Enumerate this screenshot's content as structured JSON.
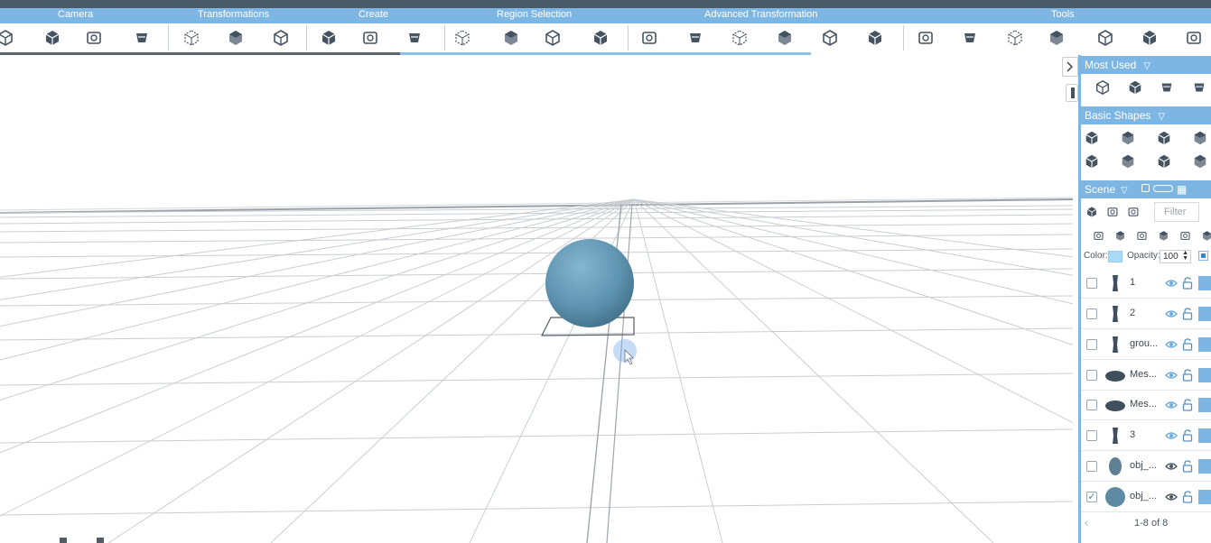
{
  "categories": [
    "Camera",
    "Transformations",
    "Create",
    "Region Selection",
    "Advanced Transformation",
    "Tools"
  ],
  "toolbar_progress": 0.33,
  "toolbar_icons": [
    "camera-front-icon",
    "camera-rotate-icon",
    "camera-snapshot-icon",
    "camera-fit-icon",
    "move-tool-icon",
    "rotate-tool-icon",
    "scale-tool-icon",
    "extrude-icon",
    "solidify-icon",
    "box-create-icon",
    "select-region-icon",
    "select-box-icon",
    "select-vertices-icon",
    "select-faces-icon",
    "stack-icon",
    "grid-box-icon",
    "bevel-icon",
    "cone-icon",
    "twist-icon",
    "bend-icon",
    "wireframe-box-icon",
    "cube-icon",
    "pattern-cube-icon",
    "sphere-cube-icon",
    "cut-cube-icon",
    "cube-outline-icon",
    "knife-icon"
  ],
  "panel": {
    "most_used_title": "Most Used",
    "basic_shapes_title": "Basic Shapes",
    "scene_title": "Scene",
    "filter_placeholder": "Filter",
    "color_label": "Color:",
    "opacity_label": "Opacity:",
    "opacity_value": "100",
    "color_value": "#a8daf6",
    "pager_text": "1-8 of 8"
  },
  "scene_objects": [
    {
      "name": "1",
      "checked": false
    },
    {
      "name": "2",
      "checked": false
    },
    {
      "name": "grou...",
      "checked": false
    },
    {
      "name": "Mes...",
      "checked": false
    },
    {
      "name": "Mes...",
      "checked": false
    },
    {
      "name": "3",
      "checked": false
    },
    {
      "name": "obj_...",
      "checked": false
    },
    {
      "name": "obj_...",
      "checked": true
    }
  ],
  "colors": {
    "accent": "#7eb6e3",
    "sphere": "#5e93b0",
    "dark_icon": "#455462"
  }
}
